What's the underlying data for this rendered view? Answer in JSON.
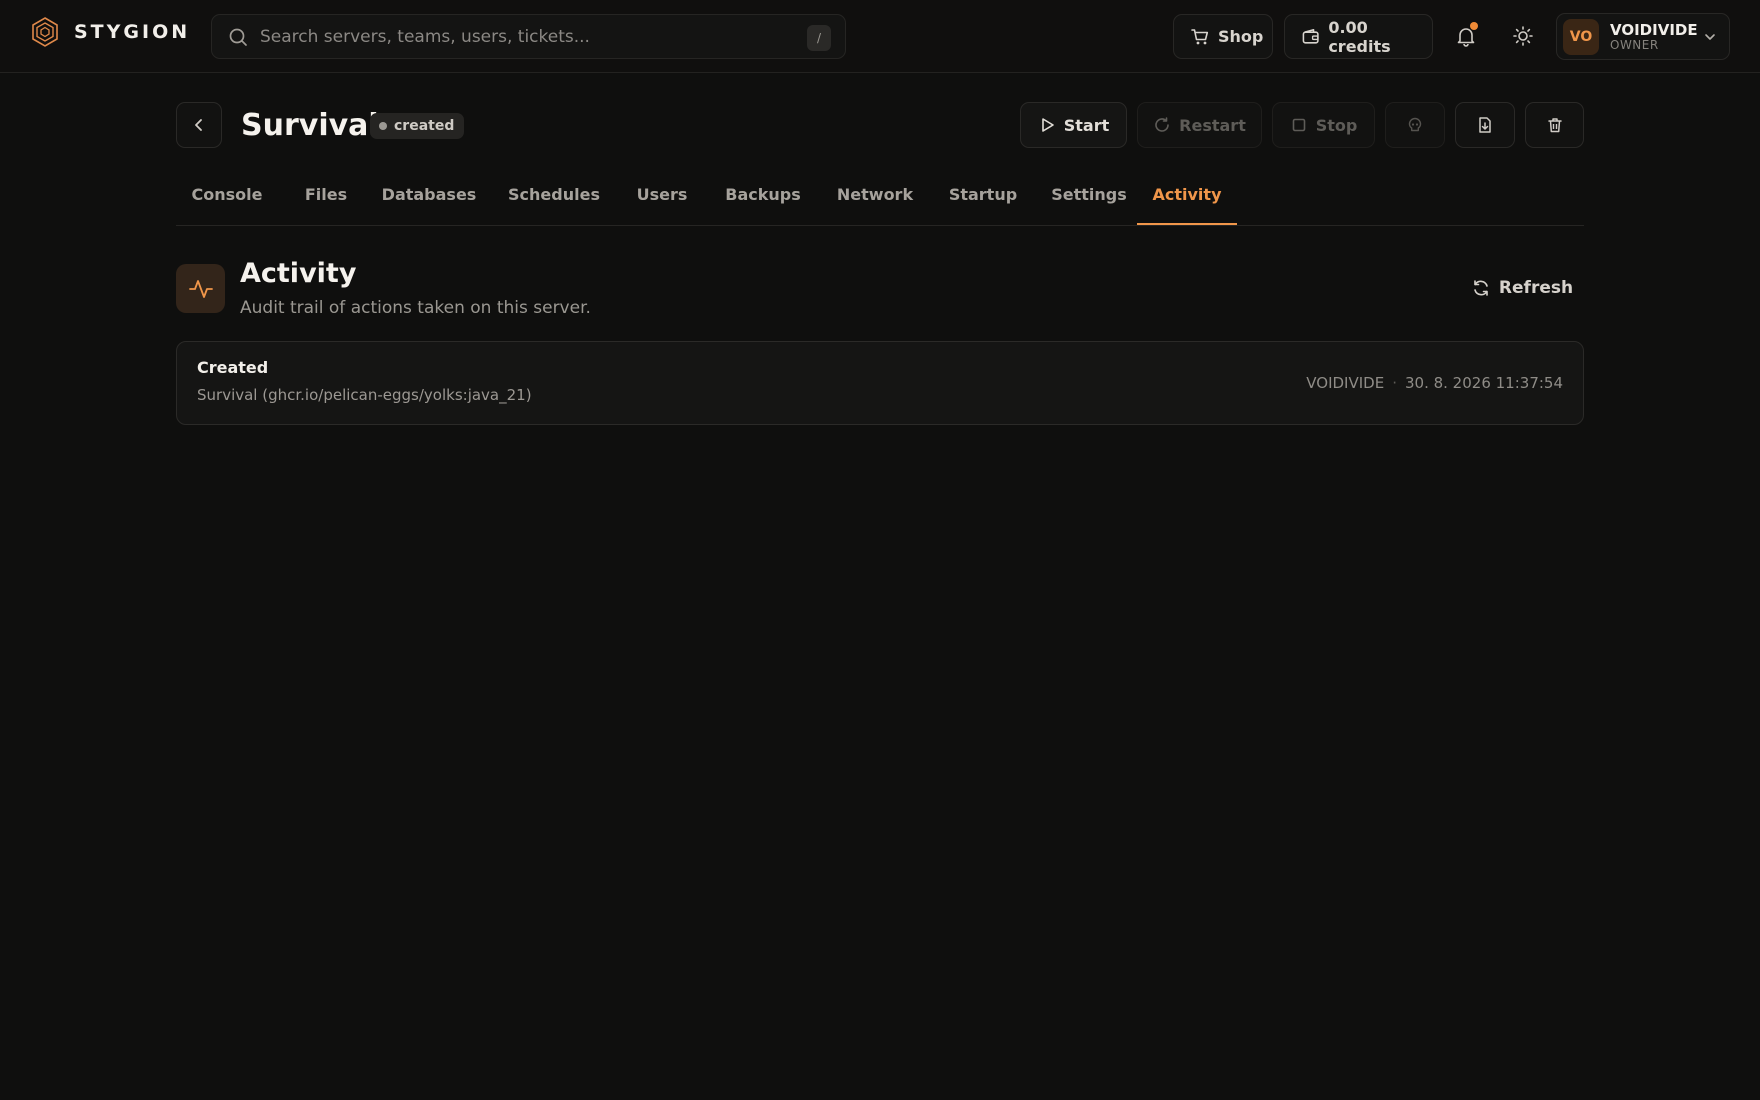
{
  "brand": {
    "name": "STYGION"
  },
  "search": {
    "placeholder": "Search servers, teams, users, tickets...",
    "shortcut": "/"
  },
  "topbar": {
    "shop_label": "Shop",
    "credits_label": "0.00 credits",
    "user": {
      "initials": "VO",
      "name": "VOIDIVIDE",
      "role": "OWNER"
    }
  },
  "server": {
    "name": "Survival",
    "status": "created",
    "actions": {
      "start": "Start",
      "restart": "Restart",
      "stop": "Stop"
    }
  },
  "tabs": [
    {
      "label": "Console"
    },
    {
      "label": "Files"
    },
    {
      "label": "Databases"
    },
    {
      "label": "Schedules"
    },
    {
      "label": "Users"
    },
    {
      "label": "Backups"
    },
    {
      "label": "Network"
    },
    {
      "label": "Startup"
    },
    {
      "label": "Settings"
    },
    {
      "label": "Activity",
      "active": true
    }
  ],
  "section": {
    "title": "Activity",
    "subtitle": "Audit trail of actions taken on this server.",
    "refresh_label": "Refresh"
  },
  "activity": [
    {
      "title": "Created",
      "description": "Survival (ghcr.io/pelican-eggs/yolks:java_21)",
      "actor": "VOIDIVIDE",
      "separator": "·",
      "timestamp": "30. 8. 2026 11:37:54"
    }
  ],
  "colors": {
    "accent": "#f0964a",
    "background": "#0f0f0e",
    "notification": "#f08a36"
  }
}
